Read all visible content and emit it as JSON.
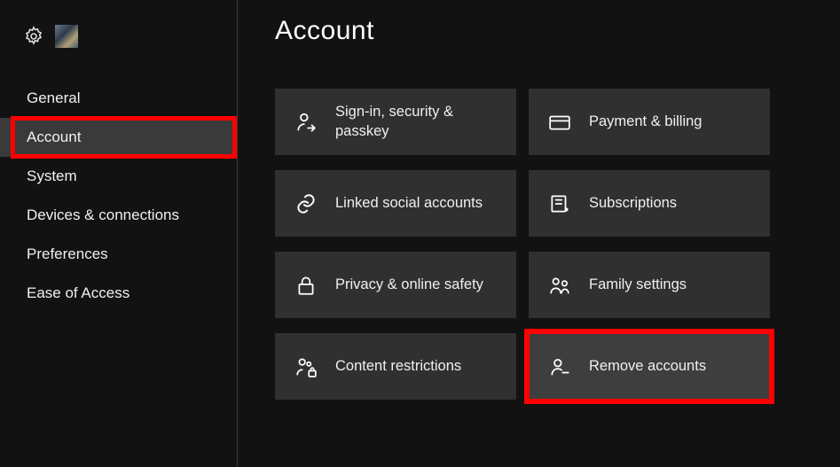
{
  "page": {
    "title": "Account"
  },
  "sidebar": {
    "items": [
      {
        "label": "General"
      },
      {
        "label": "Account"
      },
      {
        "label": "System"
      },
      {
        "label": "Devices & connections"
      },
      {
        "label": "Preferences"
      },
      {
        "label": "Ease of Access"
      }
    ]
  },
  "tiles": [
    {
      "label": "Sign-in, security & passkey",
      "icon": "person-arrow"
    },
    {
      "label": "Payment & billing",
      "icon": "card"
    },
    {
      "label": "Linked social accounts",
      "icon": "link"
    },
    {
      "label": "Subscriptions",
      "icon": "receipt"
    },
    {
      "label": "Privacy & online safety",
      "icon": "lock"
    },
    {
      "label": "Family settings",
      "icon": "family"
    },
    {
      "label": "Content restrictions",
      "icon": "people-lock"
    },
    {
      "label": "Remove accounts",
      "icon": "person-remove"
    }
  ]
}
